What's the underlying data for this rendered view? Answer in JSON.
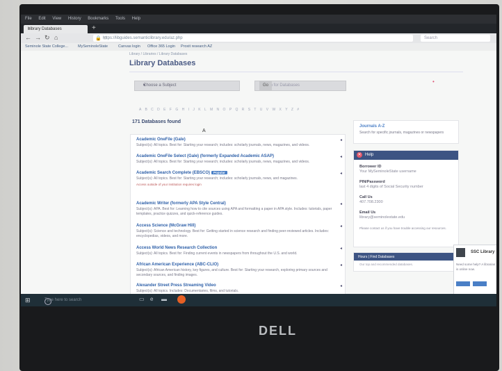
{
  "browser": {
    "menu": [
      "File",
      "Edit",
      "View",
      "History",
      "Bookmarks",
      "Tools",
      "Help"
    ],
    "tab_title": "Library Databases",
    "tab_close": "×",
    "new_tab": "+",
    "url": "https://libguides.semanticlibrary.edu/az.php",
    "search_placeholder": "Search",
    "bookmarks": [
      "Seminole State College...",
      "MySeminoleState",
      "Canvas login",
      "Office 365 Login",
      "Proxit research AZ"
    ]
  },
  "page": {
    "breadcrumb": "Library  /  Libraries  /  Library Databases",
    "title": "Library Databases",
    "subject_select": "Choose a Subject",
    "db_search_placeholder": "Search for Databases",
    "alphabet": "A B C D E F G H I J K L M N O P Q R S T U V W X Y Z #",
    "found": "171 Databases found",
    "letter_heading": "A",
    "results": [
      {
        "name": "Academic OneFile (Gale)",
        "desc": "Subject(s): All topics. Best for: Starting your research; includes: scholarly journals, news, magazines, and videos.",
        "badge": "",
        "note": ""
      },
      {
        "name": "Academic OneFile Select (Gale) (formerly Expanded Academic ASAP)",
        "desc": "Subject(s): All topics. Best for: Starting your research; includes: scholarly journals, news, magazines, and videos.",
        "badge": "",
        "note": ""
      },
      {
        "name": "Academic Search Complete (EBSCO)",
        "desc": "Subject(s): All topics. Best for: Starting your research; includes: scholarly journals, news, and magazines.",
        "badge": "Popular",
        "note": "Access outside of your institution requires login"
      },
      {
        "name": "Academic Writer (formerly APA Style Central)",
        "desc": "Subject(s): APA. Best for: Learning how to cite sources using APA and formatting a paper in APA style. Includes: tutorials, paper templates, practice quizzes, and quick-reference guides.",
        "badge": "",
        "note": ""
      },
      {
        "name": "Access Science (McGraw Hill)",
        "desc": "Subject(s): Science and technology. Best for: Getting started in science research and finding peer-reviewed articles. Includes: encyclopedias, videos, and more.",
        "badge": "",
        "note": ""
      },
      {
        "name": "Access World News Research Collection",
        "desc": "Subject(s): All topics. Best for: Finding current events in newspapers from throughout the U.S. and world.",
        "badge": "",
        "note": ""
      },
      {
        "name": "African American Experience (ABC-CLIO)",
        "desc": "Subject(s): African American history, key figures, and culture. Best for: Starting your research, exploring primary sources and secondary sources, and finding images.",
        "badge": "",
        "note": ""
      },
      {
        "name": "Alexander Street Press Streaming Video",
        "desc": "Subject(s): All topics. Includes: Documentaries, films, and tutorials.",
        "badge": "",
        "note": ""
      }
    ],
    "journals": {
      "title": "Journals A-Z",
      "desc": "Search for specific journals, magazines or newspapers"
    },
    "help_box": {
      "title": "Help",
      "items": [
        {
          "k": "Borrower ID",
          "v": "Your MySeminoleState username"
        },
        {
          "k": "PIN/Password",
          "v": "last 4 digits of Social Security number"
        },
        {
          "k": "Call Us",
          "v": "407.708.2300"
        },
        {
          "k": "Email Us",
          "v": "library@seminolestate.edu"
        }
      ],
      "footer": "Please contact us if you have trouble accessing our resources."
    },
    "hours_box": {
      "title": "Hours  |  Find Databases",
      "desc": "Our top and recommended databases."
    },
    "chat": {
      "title": "SSC Library",
      "desc": "Need some help? A librarian is online now."
    }
  },
  "taskbar": {
    "search_placeholder": "Type here to search"
  },
  "hardware": {
    "brand": "DELL"
  }
}
